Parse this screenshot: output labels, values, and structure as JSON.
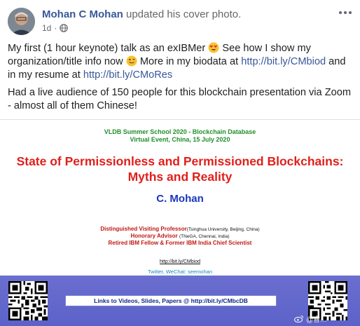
{
  "post": {
    "author": "Mohan C Mohan",
    "action": "updated his cover photo.",
    "time": "1d",
    "paragraph1_part1": "My first (1 hour keynote) talk as an exIBMer",
    "paragraph1_part2": "See how I show my organization/title info now",
    "paragraph1_part3": "More in my biodata at",
    "link1": "http://bit.ly/CMbiod",
    "paragraph1_part4": "and in my resume at",
    "link2": "http://bit.ly/CMoRes",
    "paragraph2": "Had a live audience of 150 people for this blockchain presentation via Zoom - almost all of them Chinese!"
  },
  "slide": {
    "event_line1": "VLDB Summer School 2020 - Blockchain Database",
    "event_line2": "Virtual Event, China, 15 July 2020",
    "title_line1": "State of Permissionless and Permissioned Blockchains:",
    "title_line2": "Myths and Reality",
    "author": "C. Mohan",
    "affil1_role": "Distinguished Visiting Professor",
    "affil1_org": "(Tsinghua University, Beijing, China)",
    "affil2_role": "Honorary Advisor",
    "affil2_org": "(TNeGA, Chennai, India)",
    "affil3": "Retired IBM Fellow & Former IBM India Chief Scientist",
    "url": "http://bit.ly/CMbiod",
    "twitter": "Twitter, WeChat: seemohan",
    "links_banner": "Links to Videos, Slides, Papers @ http://bit.ly/CMbcDB"
  },
  "watermark": "@睿…",
  "colors": {
    "link": "#385898",
    "slide_title": "#e0201c",
    "slide_author": "#1a35c0",
    "band": "#6a6ecf"
  }
}
